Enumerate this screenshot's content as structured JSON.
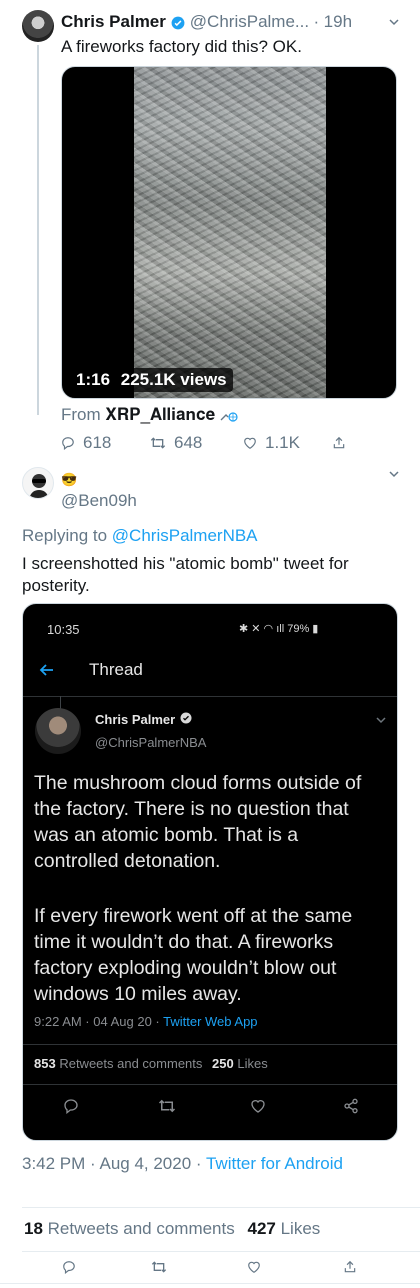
{
  "tweet1": {
    "name": "Chris Palmer",
    "handle": "@ChrisPalme...",
    "separator": "·",
    "time": "19h",
    "text": "A fireworks factory did this? OK.",
    "video": {
      "duration": "1:16",
      "views": "225.1K views"
    },
    "from_prefix": "From",
    "from_source": "𝐗𝐑𝐏_𝐀𝐥𝐥𝐢𝐚𝐧𝐜𝐞",
    "replies": "618",
    "retweets": "648",
    "likes": "1.1K"
  },
  "tweet2": {
    "name_emoji": "😎",
    "handle": "@Ben09h",
    "replying_prefix": "Replying to",
    "replying_to": "@ChrisPalmerNBA",
    "text": "I screenshotted his \"atomic bomb\" tweet for posterity.",
    "screenshot": {
      "status_time": "10:35",
      "battery": "79%",
      "header": "Thread",
      "name": "Chris Palmer",
      "handle": "@ChrisPalmerNBA",
      "para1": "The mushroom cloud forms outside of the factory. There is no question that was an atomic bomb. That is a controlled detonation.",
      "para2": "If every firework went off at the same time it wouldn’t do that. A fireworks factory exploding wouldn’t blow out windows 10 miles away.",
      "meta_time": "9:22 AM · 04 Aug 20 · ",
      "meta_app": "Twitter Web App",
      "rt_count": "853",
      "rt_label": "Retweets and comments",
      "like_count": "250",
      "like_label": "Likes"
    },
    "time_date": "3:42 PM · Aug 4, 2020 · ",
    "client": "Twitter for Android",
    "rt_count": "18",
    "rt_label": "Retweets and comments",
    "like_count": "427",
    "like_label": "Likes"
  }
}
